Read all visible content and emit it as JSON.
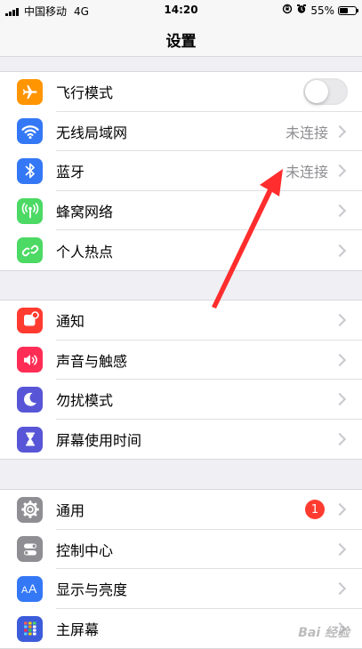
{
  "status_bar": {
    "carrier": "中国移动",
    "network": "4G",
    "time": "14:20",
    "battery_percent": "55%",
    "battery_level": 0.55
  },
  "nav": {
    "title": "设置"
  },
  "groups": [
    {
      "rows": [
        {
          "label": "飞行模式",
          "icon": "airplane-icon",
          "color": "#ff9500",
          "accessory": "toggle",
          "toggle_on": false
        },
        {
          "label": "无线局域网",
          "icon": "wifi-icon",
          "color": "#3478f6",
          "value": "未连接"
        },
        {
          "label": "蓝牙",
          "icon": "bluetooth-icon",
          "color": "#3478f6",
          "value": "未连接"
        },
        {
          "label": "蜂窝网络",
          "icon": "cellular-icon",
          "color": "#4cd964"
        },
        {
          "label": "个人热点",
          "icon": "hotspot-icon",
          "color": "#4cd964"
        }
      ]
    },
    {
      "rows": [
        {
          "label": "通知",
          "icon": "notifications-icon",
          "color": "#ff3b30"
        },
        {
          "label": "声音与触感",
          "icon": "sound-icon",
          "color": "#ff2d55"
        },
        {
          "label": "勿扰模式",
          "icon": "moon-icon",
          "color": "#5856d6"
        },
        {
          "label": "屏幕使用时间",
          "icon": "hourglass-icon",
          "color": "#5856d6"
        }
      ]
    },
    {
      "rows": [
        {
          "label": "通用",
          "icon": "gear-icon",
          "color": "#8e8e93",
          "badge": "1"
        },
        {
          "label": "控制中心",
          "icon": "control-center-icon",
          "color": "#8e8e93"
        },
        {
          "label": "显示与亮度",
          "icon": "display-icon",
          "color": "#3478f6"
        },
        {
          "label": "主屏幕",
          "icon": "home-screen-icon",
          "color": "#3c5cdb"
        }
      ]
    }
  ],
  "annotation": {
    "icon": "red-arrow-icon",
    "color": "#ff2d2d"
  },
  "watermark": "Bai 经验"
}
